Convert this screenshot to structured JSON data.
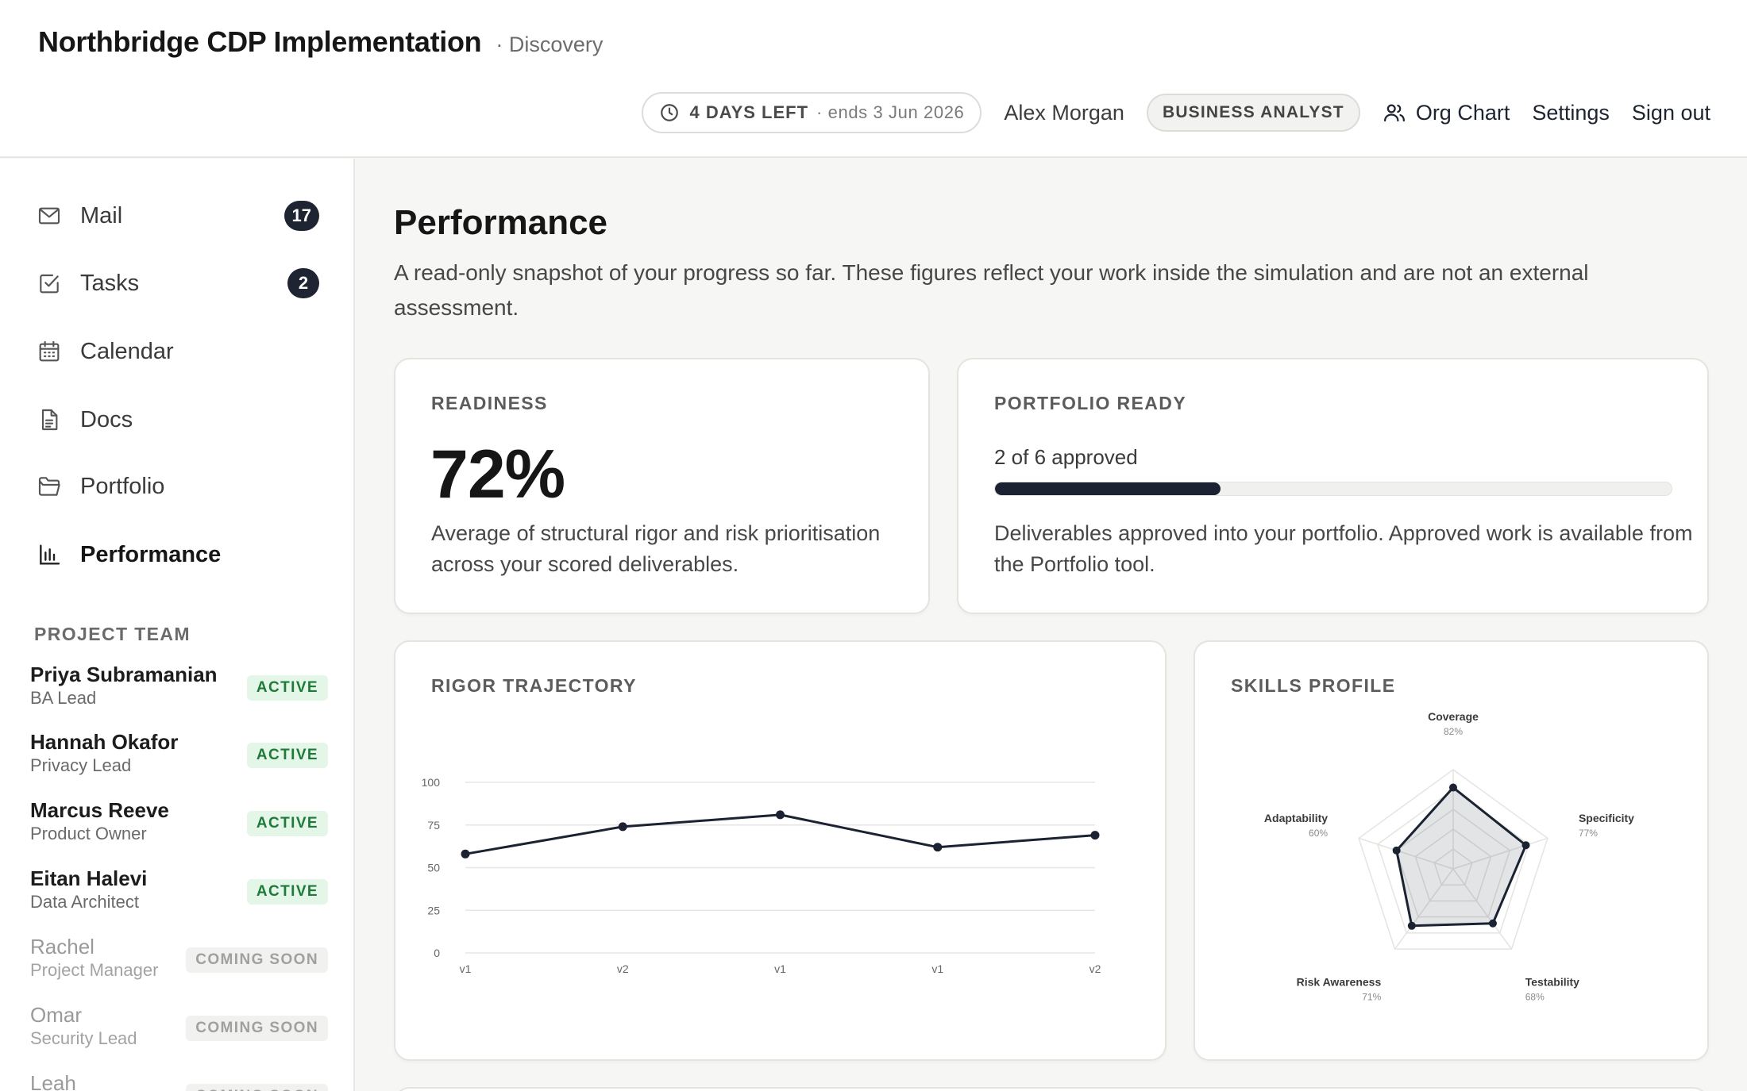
{
  "header": {
    "title": "Northbridge CDP Implementation",
    "phase": "· Discovery",
    "deadline_days": "4 DAYS LEFT",
    "deadline_end": "· ends 3 Jun 2026",
    "user_name": "Alex Morgan",
    "role": "BUSINESS ANALYST",
    "org_chart_label": "Org Chart",
    "settings_label": "Settings",
    "signout_label": "Sign out"
  },
  "sidebar": {
    "items": [
      {
        "label": "Mail",
        "icon": "mail-icon",
        "count": "17"
      },
      {
        "label": "Tasks",
        "icon": "checkbox-icon",
        "count": "2"
      },
      {
        "label": "Calendar",
        "icon": "calendar-icon"
      },
      {
        "label": "Docs",
        "icon": "document-icon"
      },
      {
        "label": "Portfolio",
        "icon": "folder-icon"
      },
      {
        "label": "Performance",
        "icon": "bar-chart-icon",
        "active": true
      }
    ],
    "team_heading": "PROJECT TEAM",
    "team": [
      {
        "name": "Priya Subramanian",
        "role": "BA Lead",
        "status": "ACTIVE"
      },
      {
        "name": "Hannah Okafor",
        "role": "Privacy Lead",
        "status": "ACTIVE"
      },
      {
        "name": "Marcus Reeve",
        "role": "Product Owner",
        "status": "ACTIVE"
      },
      {
        "name": "Eitan Halevi",
        "role": "Data Architect",
        "status": "ACTIVE"
      },
      {
        "name": "Rachel",
        "role": "Project Manager",
        "status": "COMING SOON"
      },
      {
        "name": "Omar",
        "role": "Security Lead",
        "status": "COMING SOON"
      },
      {
        "name": "Leah",
        "role": "",
        "status": "COMING SOON"
      }
    ]
  },
  "main": {
    "title": "Performance",
    "description": "A read-only snapshot of your progress so far. These figures reflect your work inside the simulation and are not an external assessment.",
    "readiness": {
      "label": "READINESS",
      "value": "72%",
      "text": "Average of structural rigor and risk prioritisation across your scored deliverables."
    },
    "portfolio": {
      "label": "PORTFOLIO READY",
      "caption": "2 of 6 approved",
      "approved": 2,
      "total": 6,
      "text": "Deliverables approved into your portfolio. Approved work is available from the Portfolio tool."
    },
    "rigor_label": "RIGOR TRAJECTORY",
    "skills_label": "SKILLS PROFILE"
  },
  "colors": {
    "accent": "#1b2332",
    "active_badge_bg": "#e3f6e7",
    "active_badge_text": "#1f7a3a"
  },
  "chart_data": [
    {
      "type": "line",
      "title": "RIGOR TRAJECTORY",
      "x": [
        "v1",
        "v2",
        "v1",
        "v1",
        "v2"
      ],
      "y": [
        58,
        74,
        81,
        62,
        69
      ],
      "yticks": [
        0,
        25,
        50,
        75,
        100
      ],
      "ylim": [
        0,
        100
      ],
      "grid": true
    },
    {
      "type": "radar",
      "title": "SKILLS PROFILE",
      "categories": [
        "Coverage",
        "Specificity",
        "Testability",
        "Risk Awareness",
        "Adaptability"
      ],
      "value_labels": [
        "82%",
        "77%",
        "68%",
        "71%",
        "60%"
      ],
      "values": [
        82,
        77,
        68,
        71,
        60
      ],
      "max": 100
    }
  ]
}
